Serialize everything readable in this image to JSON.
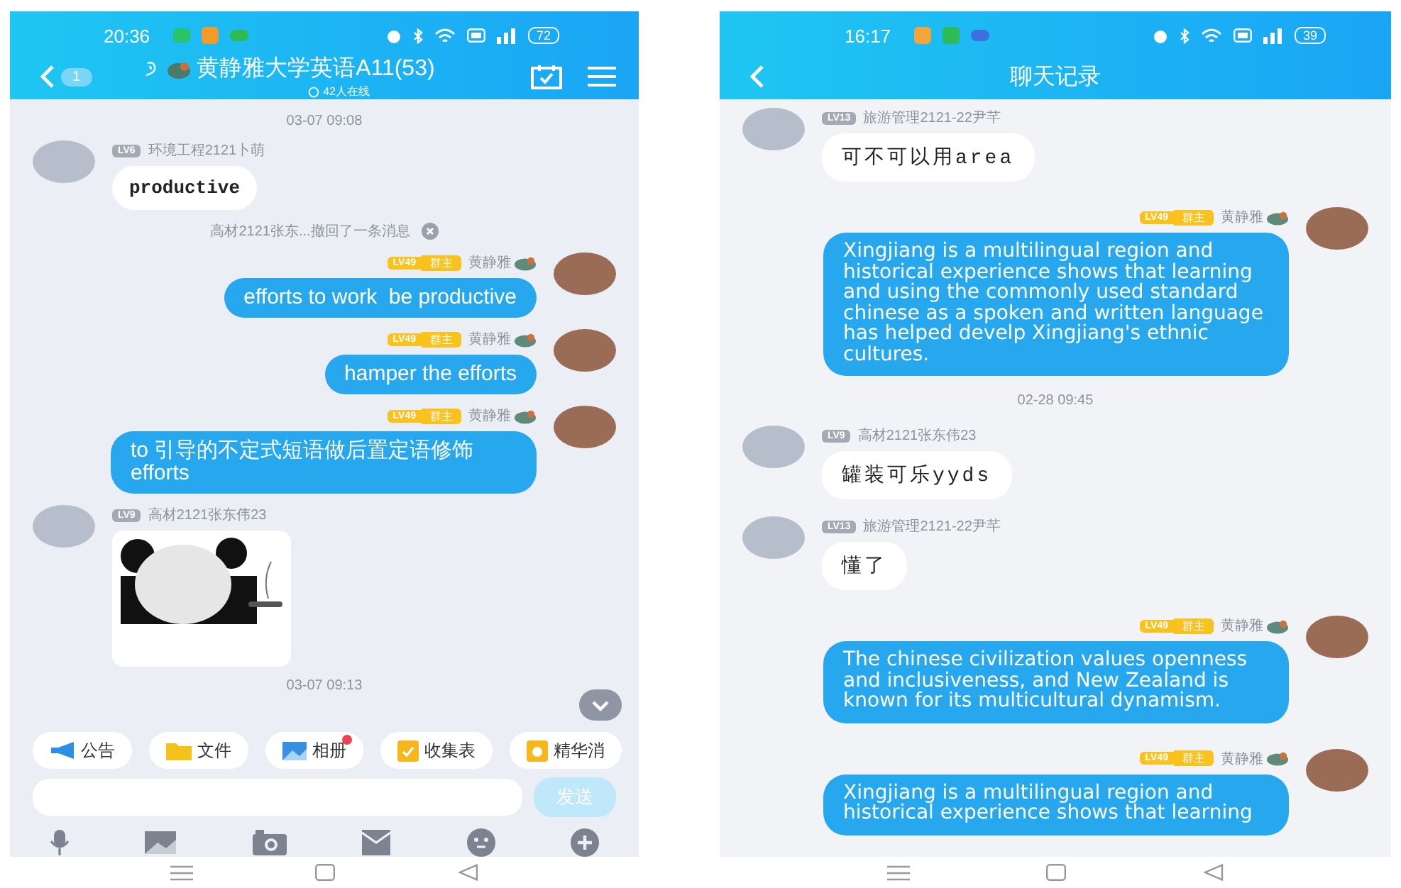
{
  "phones": [
    {
      "kind": "group",
      "status_bar": {
        "time": "20:36",
        "battery": "72"
      },
      "header": {
        "title": "黄静雅大学英语A11(53)",
        "subtitle": "42人在线",
        "unread": "1"
      },
      "messages": [
        {
          "kind": "time",
          "text": "03-07 09:08"
        },
        {
          "kind": "text",
          "outgoing": false,
          "rank": "LV6",
          "sender": "环境工程2121卜萌",
          "text": "productive"
        },
        {
          "kind": "notice",
          "text": "高材2121张东...撤回了一条消息"
        },
        {
          "kind": "text",
          "outgoing": true,
          "rank": "LV49",
          "role": "群主",
          "sender": "黄静雅",
          "text": "efforts to work  be productive"
        },
        {
          "kind": "text",
          "outgoing": true,
          "rank": "LV49",
          "role": "群主",
          "sender": "黄静雅",
          "text": "hamper the efforts"
        },
        {
          "kind": "text",
          "outgoing": true,
          "rank": "LV49",
          "role": "群主",
          "sender": "黄静雅",
          "text": "to 引导的不定式短语做后置定语修饰efforts"
        },
        {
          "kind": "sticker",
          "outgoing": false,
          "rank": "LV9",
          "sender": "高材2121张东伟23"
        },
        {
          "kind": "time",
          "text": "03-07 09:13"
        }
      ],
      "shortcuts": [
        {
          "label": "公告",
          "badge": false
        },
        {
          "label": "文件",
          "badge": false
        },
        {
          "label": "相册",
          "badge": true
        },
        {
          "label": "收集表",
          "badge": false
        },
        {
          "label": "精华消",
          "badge": false
        }
      ],
      "send_button": {
        "label": "发送",
        "disabled": true
      }
    },
    {
      "kind": "history",
      "status_bar": {
        "time": "16:17",
        "battery": "39"
      },
      "header": {
        "title": "聊天记录"
      },
      "messages": [
        {
          "kind": "text",
          "outgoing": false,
          "rank": "LV13",
          "sender": "旅游管理2121-22尹芊",
          "text": "可不可以用area"
        },
        {
          "kind": "text",
          "outgoing": true,
          "rank": "LV49",
          "role": "群主",
          "sender": "黄静雅",
          "text": "Xingjiang is a multilingual region and historical experience shows that learning and using the commonly used standard chinese as a spoken and written language has helped develp Xingjiang's ethnic cultures."
        },
        {
          "kind": "time",
          "text": "02-28 09:45"
        },
        {
          "kind": "text",
          "outgoing": false,
          "rank": "LV9",
          "sender": "高材2121张东伟23",
          "text": "罐装可乐yyds"
        },
        {
          "kind": "text",
          "outgoing": false,
          "rank": "LV13",
          "sender": "旅游管理2121-22尹芊",
          "text": "懂了"
        },
        {
          "kind": "text",
          "outgoing": true,
          "rank": "LV49",
          "role": "群主",
          "sender": "黄静雅",
          "text": "The chinese civilization values openness and inclusiveness, and New Zealand is known for its multicultural dynamism."
        },
        {
          "kind": "text",
          "outgoing": true,
          "rank": "LV49",
          "role": "群主",
          "sender": "黄静雅",
          "text": "Xingjiang is a multilingual region and historical experience shows that learning"
        }
      ]
    }
  ]
}
